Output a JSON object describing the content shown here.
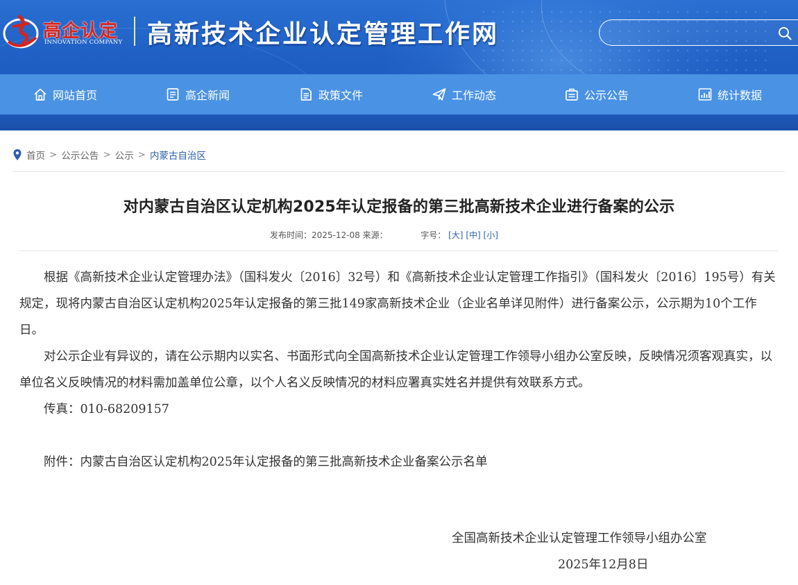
{
  "header": {
    "logo_cn": "高企认定",
    "logo_en": "INNOVATION COMPANY",
    "site_title": "高新技术企业认定管理工作网",
    "search_placeholder": "",
    "colors": {
      "header_bg": "#2a6fd1",
      "nav_bg": "#4a92e4",
      "logo_red": "#d8231c",
      "link_blue": "#2b5fae"
    }
  },
  "nav": {
    "items": [
      {
        "label": "网站首页",
        "icon": "home-icon"
      },
      {
        "label": "高企新闻",
        "icon": "news-icon"
      },
      {
        "label": "政策文件",
        "icon": "document-icon"
      },
      {
        "label": "工作动态",
        "icon": "paper-plane-icon"
      },
      {
        "label": "公示公告",
        "icon": "notice-icon"
      },
      {
        "label": "统计数据",
        "icon": "chart-icon"
      }
    ]
  },
  "breadcrumb": {
    "items": [
      "首页",
      "公示公告",
      "公示"
    ],
    "current": "内蒙古自治区",
    "separator": ">"
  },
  "article": {
    "title": "对内蒙古自治区认定机构2025年认定报备的第三批高新技术企业进行备案的公示",
    "publish_label": "发布时间：",
    "publish_date": "2025-12-08",
    "source_label": "来源：",
    "font_size_label": "字号：",
    "font_size_large": "[大]",
    "font_size_medium": "[中]",
    "font_size_small": "[小]",
    "paragraph_1": "根据《高新技术企业认定管理办法》（国科发火〔2016〕32号）和《高新技术企业认定管理工作指引》（国科发火〔2016〕195号）有关规定，现将内蒙古自治区认定机构2025年认定报备的第三批149家高新技术企业（企业名单详见附件）进行备案公示，公示期为10个工作日。",
    "paragraph_2": "对公示企业有异议的，请在公示期内以实名、书面形式向全国高新技术企业认定管理工作领导小组办公室反映，反映情况须客观真实，以单位名义反映情况的材料需加盖单位公章，以个人名义反映情况的材料应署真实姓名并提供有效联系方式。",
    "fax": "传真：010-68209157",
    "attachment": "附件：内蒙古自治区认定机构2025年认定报备的第三批高新技术企业备案公示名单",
    "signature": "全国高新技术企业认定管理工作领导小组办公室",
    "sign_date": "2025年12月8日"
  }
}
